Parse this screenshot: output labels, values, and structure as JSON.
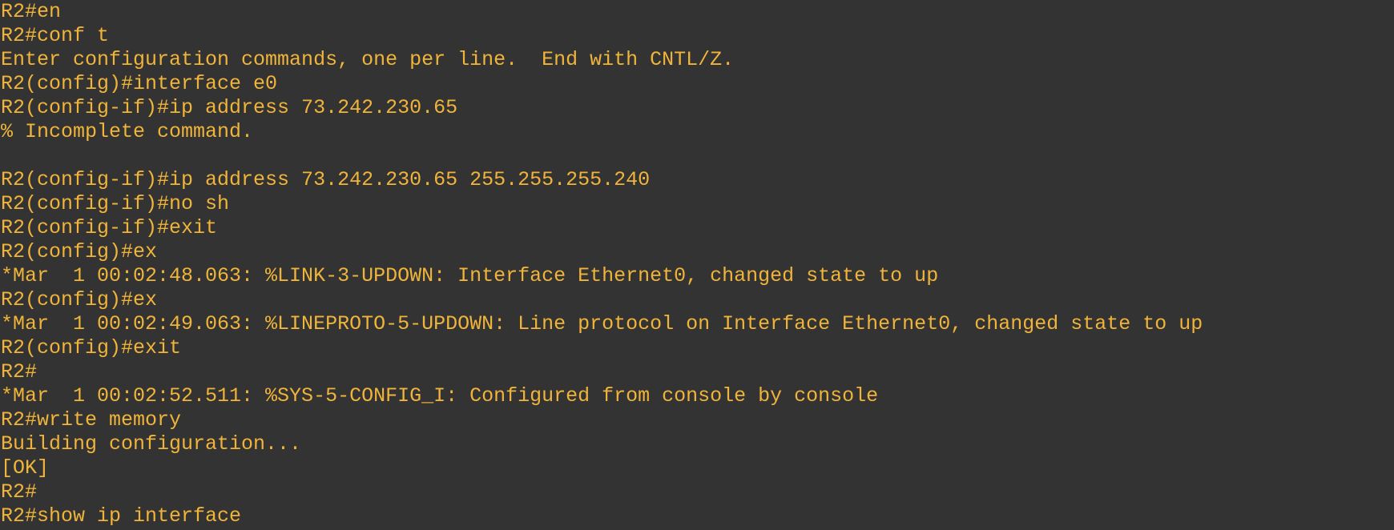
{
  "colors": {
    "background": "#333333",
    "text": "#f0b43a"
  },
  "terminal": {
    "lines": [
      "R2#en",
      "R2#conf t",
      "Enter configuration commands, one per line.  End with CNTL/Z.",
      "R2(config)#interface e0",
      "R2(config-if)#ip address 73.242.230.65",
      "% Incomplete command.",
      "",
      "R2(config-if)#ip address 73.242.230.65 255.255.255.240",
      "R2(config-if)#no sh",
      "R2(config-if)#exit",
      "R2(config)#ex",
      "*Mar  1 00:02:48.063: %LINK-3-UPDOWN: Interface Ethernet0, changed state to up",
      "R2(config)#ex",
      "*Mar  1 00:02:49.063: %LINEPROTO-5-UPDOWN: Line protocol on Interface Ethernet0, changed state to up",
      "R2(config)#exit",
      "R2#",
      "*Mar  1 00:02:52.511: %SYS-5-CONFIG_I: Configured from console by console",
      "R2#write memory",
      "Building configuration...",
      "[OK]",
      "R2#",
      "R2#show ip interface"
    ]
  }
}
